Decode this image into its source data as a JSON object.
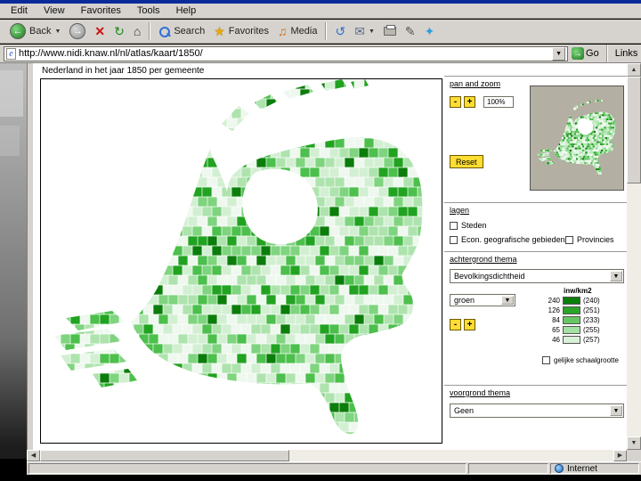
{
  "window": {
    "menu": [
      "Edit",
      "View",
      "Favorites",
      "Tools",
      "Help"
    ],
    "toolbar": {
      "back": "Back",
      "search": "Search",
      "favorites": "Favorites",
      "media": "Media"
    },
    "address": {
      "url": "http://www.nidi.knaw.nl/nl/atlas/kaart/1850/",
      "go": "Go",
      "links": "Links"
    },
    "status": {
      "zone": "Internet"
    }
  },
  "page": {
    "title": "Nederland in het jaar 1850 per gemeente",
    "panzoom": {
      "header": "pan and zoom",
      "minus": "-",
      "plus": "+",
      "zoom": "100%",
      "reset": "Reset"
    },
    "layers": {
      "header": "lagen",
      "items": [
        "Steden",
        "Econ. geografische gebieden",
        "Provincies"
      ]
    },
    "background": {
      "header": "achtergrond thema",
      "selected": "Bevolkingsdichtheid",
      "palette_selected": "groen",
      "legend": {
        "unit": "inw/km2",
        "rows": [
          {
            "value": "240",
            "count": "(240)",
            "color": "#0b7d0b"
          },
          {
            "value": "126",
            "count": "(251)",
            "color": "#2aa52a"
          },
          {
            "value": "84",
            "count": "(233)",
            "color": "#66c766"
          },
          {
            "value": "65",
            "count": "(255)",
            "color": "#a5e0a5"
          },
          {
            "value": "46",
            "count": "(257)",
            "color": "#d8f2d8"
          }
        ]
      },
      "equal_scale": "gelijke schaalgrootte"
    },
    "foreground": {
      "header": "voorgrond thema",
      "selected": "Geen"
    }
  },
  "map": {
    "palette": [
      "#eef8ee",
      "#d2efd2",
      "#aee3ae",
      "#7fd47f",
      "#4cbf4c",
      "#21a321",
      "#0b7d0b"
    ],
    "water": "#ffffff"
  }
}
